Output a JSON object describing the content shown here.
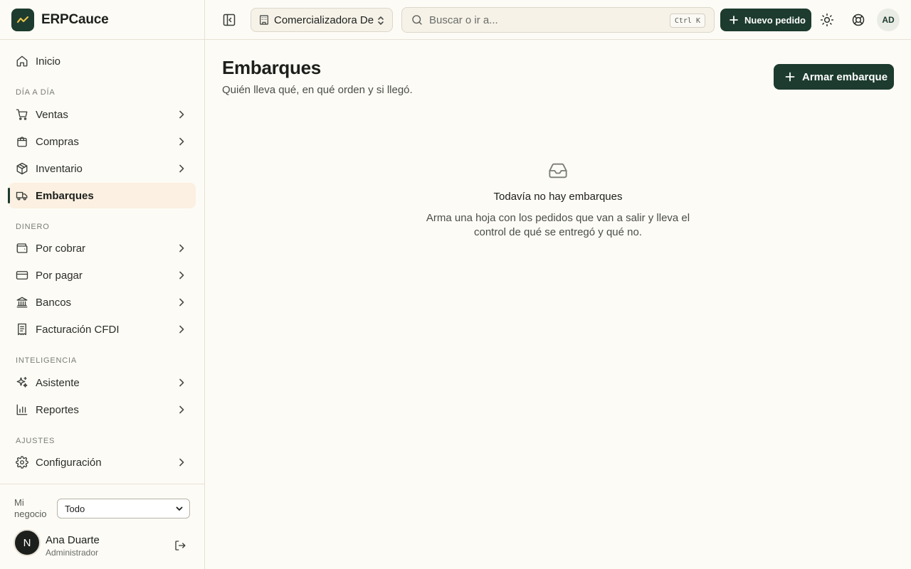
{
  "brand": {
    "name": "ERPCauce"
  },
  "topbar": {
    "company": "Comercializadora Del Norte",
    "search_placeholder": "Buscar o ir a...",
    "shortcut": "Ctrl K",
    "new_order": "Nuevo pedido",
    "avatar_initials": "AD"
  },
  "sidebar": {
    "home": "Inicio",
    "sections": {
      "daily": "Día a día",
      "money": "Dinero",
      "intelligence": "Inteligencia",
      "settings": "Ajustes"
    },
    "items": {
      "ventas": "Ventas",
      "compras": "Compras",
      "inventario": "Inventario",
      "embarques": "Embarques",
      "por_cobrar": "Por cobrar",
      "por_pagar": "Por pagar",
      "bancos": "Bancos",
      "facturacion": "Facturación CFDI",
      "asistente": "Asistente",
      "reportes": "Reportes",
      "configuracion": "Configuración"
    },
    "active_item": "Embarques",
    "business_label": "Mi negocio",
    "business_value": "Todo",
    "user": {
      "initial": "N",
      "name": "Ana Duarte",
      "role": "Administrador"
    }
  },
  "main": {
    "title": "Embarques",
    "subtitle": "Quién lleva qué, en qué orden y si llegó.",
    "action": "Armar embarque",
    "empty": {
      "title": "Todavía no hay embarques",
      "description": "Arma una hoja con los pedidos que van a salir y lleva el control de qué se entregó y qué no."
    }
  },
  "colors": {
    "accent": "#1d3b2f",
    "active_bg": "#fbf0e1",
    "background": "#fdfbf5"
  }
}
